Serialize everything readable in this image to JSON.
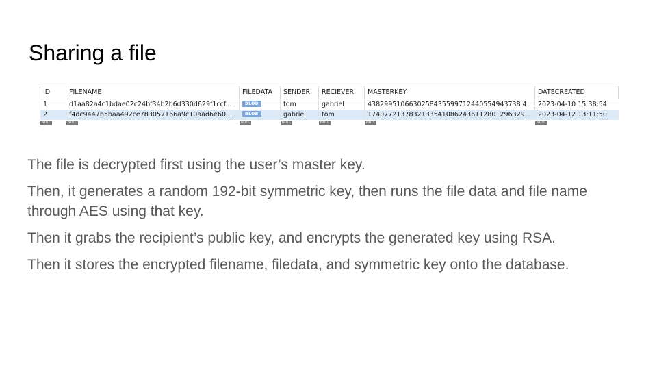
{
  "slide": {
    "title": "Sharing a file"
  },
  "table": {
    "columns": [
      "ID",
      "FILENAME",
      "FILEDATA",
      "SENDER",
      "RECIEVER",
      "MASTERKEY",
      "DATECREATED"
    ],
    "rows": [
      {
        "id": "1",
        "filename": "d1aa82a4c1bdae02c24bf34b2b6d330d629f1ccf...",
        "filedata": "BLOB",
        "sender": "tom",
        "reciever": "gabriel",
        "masterkey": "4382995106630258435599712440554943738 4...",
        "datecreated": "2023-04-10 15:38:54"
      },
      {
        "id": "2",
        "filename": "f4dc9447b5baa492ce783057166a9c10aad6e60...",
        "filedata": "BLOB",
        "sender": "gabriel",
        "reciever": "tom",
        "masterkey": "17407721378321335410862436112801296329...",
        "datecreated": "2023-04-12 13:11:50"
      }
    ],
    "null_label": "NULL"
  },
  "paragraphs": [
    "The file is decrypted first using the user’s master key.",
    "Then, it generates a random 192-bit symmetric key, then runs the file data and file name through AES using that key.",
    "Then it grabs the recipient’s public key, and encrypts the generated key using RSA.",
    "Then it stores the encrypted filename, filedata, and symmetric key onto the database."
  ]
}
